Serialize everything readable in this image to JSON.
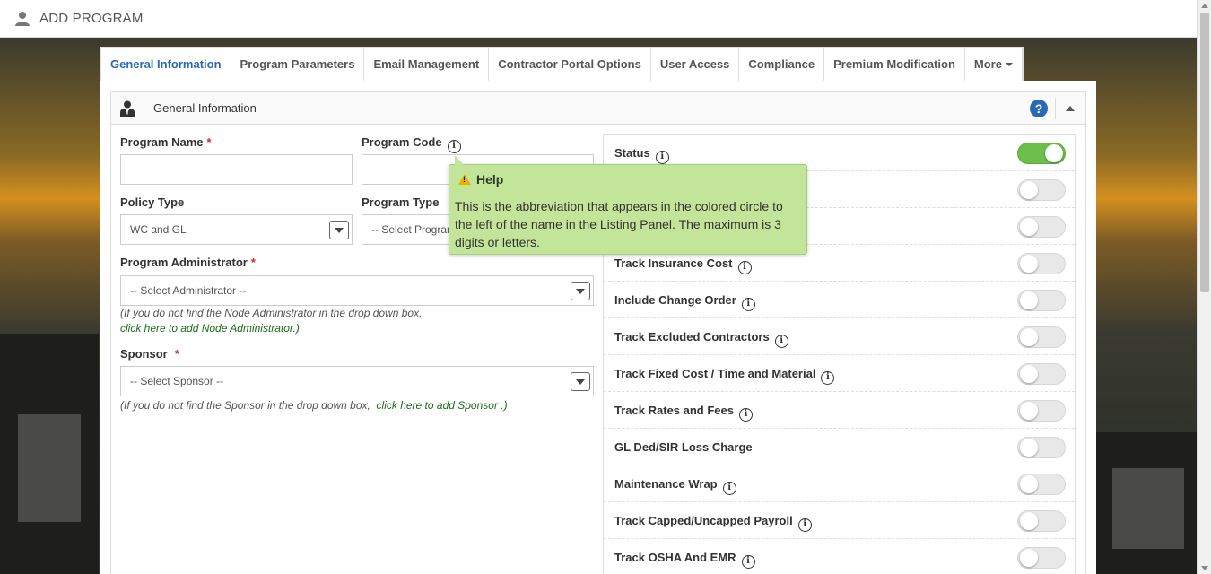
{
  "header": {
    "title": "ADD PROGRAM",
    "icon": "user-icon"
  },
  "tabs": [
    {
      "label": "General Information",
      "active": true
    },
    {
      "label": "Program Parameters"
    },
    {
      "label": "Email Management"
    },
    {
      "label": "Contractor Portal Options"
    },
    {
      "label": "User Access"
    },
    {
      "label": "Compliance"
    },
    {
      "label": "Premium Modification"
    },
    {
      "label": "More"
    }
  ],
  "panel": {
    "title": "General Information",
    "help_symbol": "?"
  },
  "form": {
    "program_name": {
      "label": "Program Name",
      "required": "*",
      "value": ""
    },
    "program_code": {
      "label": "Program Code",
      "value": ""
    },
    "policy_type": {
      "label": "Policy Type",
      "value": "WC and GL"
    },
    "program_type": {
      "label": "Program Type",
      "value": "-- Select Program Type --"
    },
    "administrator": {
      "label": "Program Administrator",
      "required": "*",
      "value": "-- Select Administrator --",
      "note": "(If you do not find the Node Administrator in the drop down box,",
      "link": "click here to add Node Administrator.)"
    },
    "sponsor": {
      "label": "Sponsor",
      "required": "*",
      "value": "-- Select Sponsor --",
      "note": "(If you do not find the Sponsor in the drop down box,",
      "link": "click here to add Sponsor .)"
    }
  },
  "toggles": [
    {
      "label": "Status",
      "on": true,
      "info": true
    },
    {
      "label": "",
      "on": false,
      "info": false
    },
    {
      "label": "",
      "on": false,
      "info": false
    },
    {
      "label": "Track Insurance Cost",
      "on": false,
      "info": true
    },
    {
      "label": "Include Change Order",
      "on": false,
      "info": true
    },
    {
      "label": "Track Excluded Contractors",
      "on": false,
      "info": true
    },
    {
      "label": "Track Fixed Cost / Time and Material",
      "on": false,
      "info": true
    },
    {
      "label": "Track Rates and Fees",
      "on": false,
      "info": true
    },
    {
      "label": "GL Ded/SIR Loss Charge",
      "on": false,
      "info": false
    },
    {
      "label": "Maintenance Wrap",
      "on": false,
      "info": true
    },
    {
      "label": "Track Capped/Uncapped Payroll",
      "on": false,
      "info": true
    },
    {
      "label": "Track OSHA And EMR",
      "on": false,
      "info": true
    }
  ],
  "popover": {
    "title": "Help",
    "body": "This is the abbreviation that appears in the colored circle to the left of the name in the Listing Panel. The maximum is 3 digits or letters."
  },
  "colors": {
    "accent": "#2a6ab5",
    "toggle_on": "#6bbf4a",
    "popover_bg": "#c2e59a",
    "required": "#c9302c",
    "link": "#1e6b1e"
  }
}
